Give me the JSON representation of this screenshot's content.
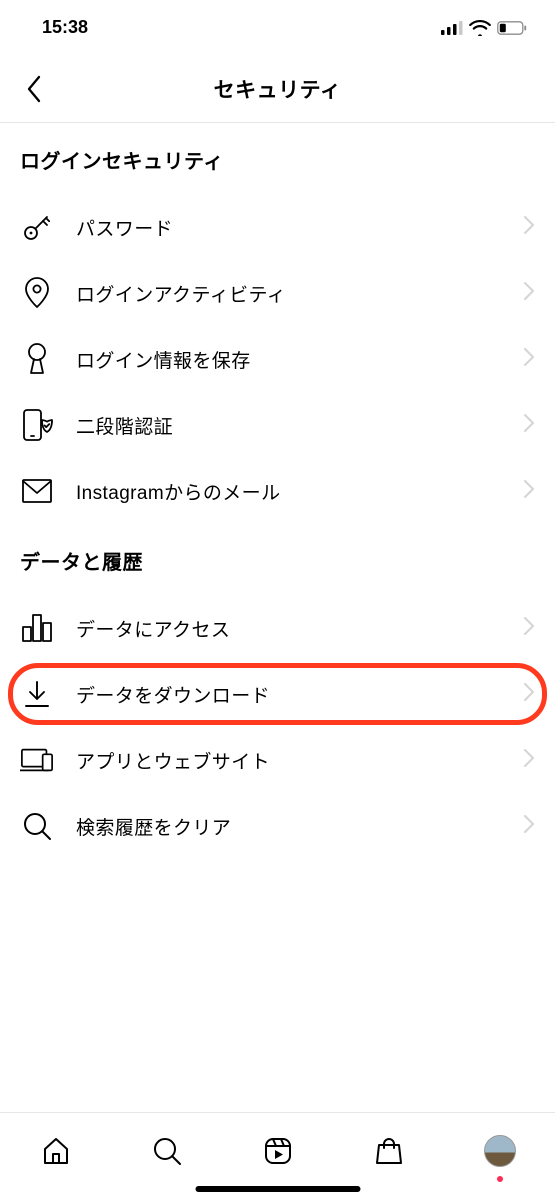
{
  "status": {
    "time": "15:38"
  },
  "header": {
    "title": "セキュリティ"
  },
  "sections": {
    "login": {
      "title": "ログインセキュリティ",
      "items": {
        "password": "パスワード",
        "activity": "ログインアクティビティ",
        "saveInfo": "ログイン情報を保存",
        "twoFactor": "二段階認証",
        "emails": "Instagramからのメール"
      }
    },
    "data": {
      "title": "データと履歴",
      "items": {
        "access": "データにアクセス",
        "download": "データをダウンロード",
        "apps": "アプリとウェブサイト",
        "clearSearch": "検索履歴をクリア"
      }
    }
  }
}
